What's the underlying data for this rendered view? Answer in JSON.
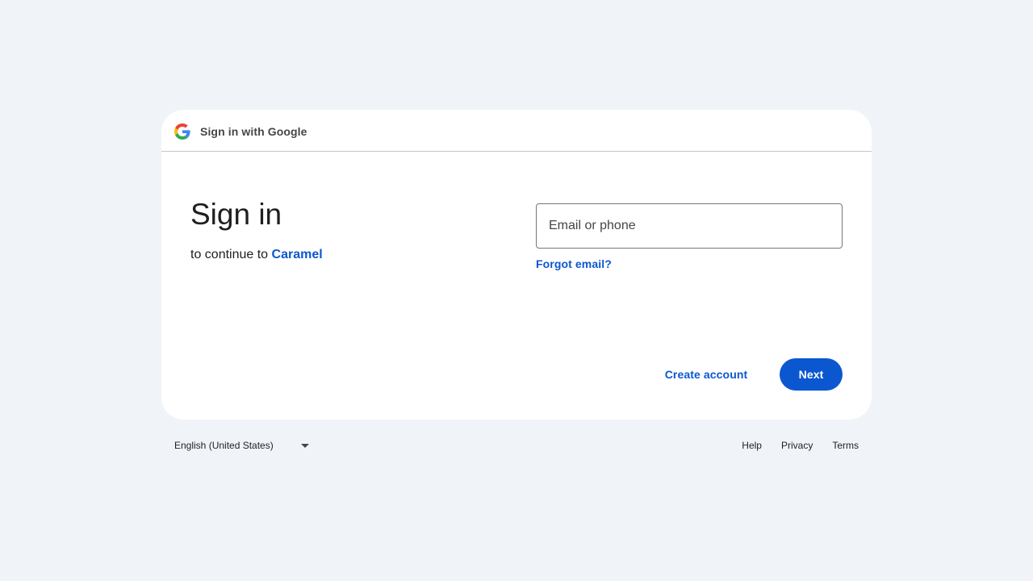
{
  "header": {
    "title": "Sign in with Google",
    "logo_icon": "google-g-icon"
  },
  "main": {
    "heading": "Sign in",
    "subtitle_prefix": "to continue to",
    "app_name": "Caramel"
  },
  "form": {
    "email_value": "",
    "email_placeholder": "Email or phone",
    "forgot_email_label": "Forgot email?"
  },
  "actions": {
    "create_account_label": "Create account",
    "next_label": "Next"
  },
  "footer": {
    "language_selected": "English (United States)",
    "links": [
      "Help",
      "Privacy",
      "Terms"
    ]
  },
  "colors": {
    "page_background": "#f0f4f9",
    "card_background": "#ffffff",
    "accent": "#0b57d0",
    "text_primary": "#1f1f1f",
    "text_secondary": "#444746"
  }
}
